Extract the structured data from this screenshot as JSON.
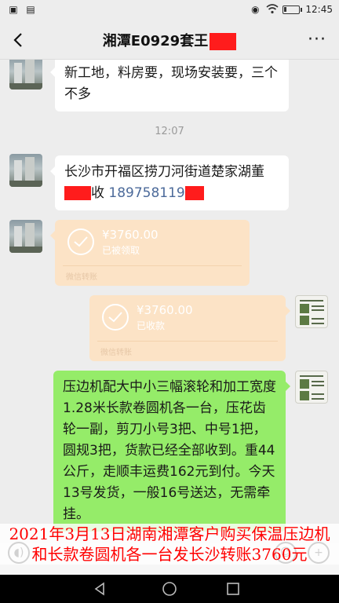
{
  "status_bar": {
    "time": "12:45",
    "left_icons": [
      "app-icon",
      "notification-icon"
    ],
    "right_icons": [
      "eye-comfort-icon",
      "wifi-icon",
      "battery-icon"
    ],
    "battery_level": 0.15
  },
  "header": {
    "title": "湘潭E0929套王",
    "back_label": "<",
    "more_label": "···"
  },
  "messages": [
    {
      "side": "left",
      "type": "text",
      "text": "新工地，料房要，现场安装要，三个不多"
    },
    {
      "type": "time",
      "text": "12:07"
    },
    {
      "side": "left",
      "type": "text",
      "text_before": "长沙市开福区捞刀河街道楚家湖董",
      "text_middle": "收",
      "phone": "189758119"
    },
    {
      "side": "left",
      "type": "transfer",
      "amount": "¥3760.00",
      "status": "已被领取",
      "source": "微信转账"
    },
    {
      "side": "right",
      "type": "transfer",
      "amount": "¥3760.00",
      "status": "已收款",
      "source": "微信转账"
    },
    {
      "side": "right",
      "type": "text",
      "text": "压边机配大中小三幅滚轮和加工宽度1.28米长款卷圆机各一台，压花齿轮一副，剪刀小号3把、中号1把，圆规3把，货款已经全部收到。重44公斤，走顺丰运费162元到付。今天13号发货，一般16号送达，无需牵挂。"
    }
  ],
  "caption": {
    "line1": "2021年3月13日湖南湘潭客户购买保温压边机",
    "line2": "和长款卷圆机各一台发长沙转账3760元"
  },
  "colors": {
    "background": "#ededed",
    "green_bubble": "#95ec69",
    "transfer_bubble": "#fce3c6",
    "redaction": "#ff1c1c",
    "caption_text": "#ff0000"
  },
  "android_nav": [
    "back-triangle-icon",
    "home-circle-icon",
    "recents-square-icon"
  ]
}
